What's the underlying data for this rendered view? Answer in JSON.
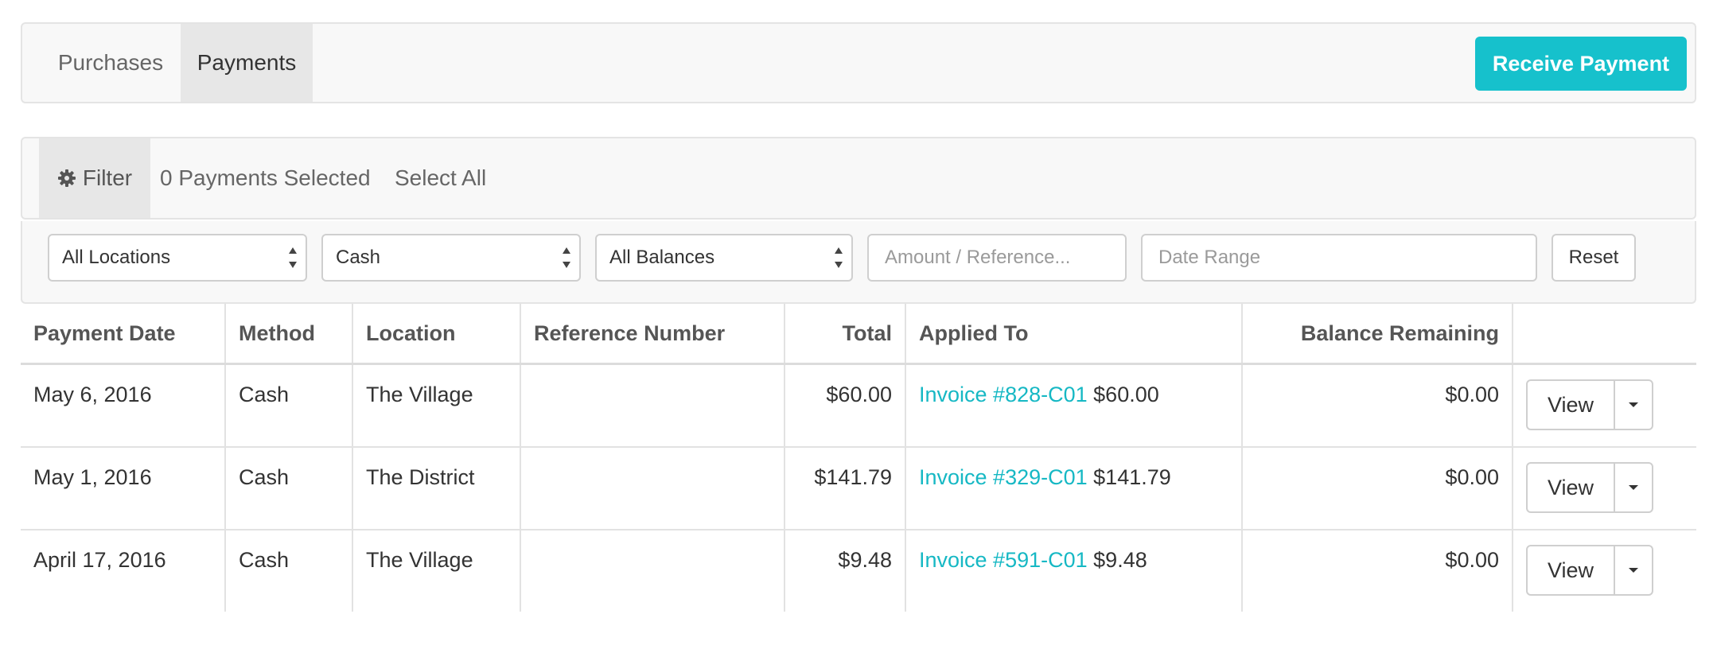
{
  "tabs": {
    "purchases": "Purchases",
    "payments": "Payments",
    "receive_payment": "Receive Payment"
  },
  "filterbar": {
    "filter_label": "Filter",
    "selected_count": "0 Payments Selected",
    "select_all": "Select All"
  },
  "controls": {
    "location_value": "All Locations",
    "method_value": "Cash",
    "balance_value": "All Balances",
    "amount_placeholder": "Amount / Reference...",
    "date_placeholder": "Date Range",
    "reset_label": "Reset"
  },
  "table": {
    "headers": {
      "payment_date": "Payment Date",
      "method": "Method",
      "location": "Location",
      "reference_number": "Reference Number",
      "total": "Total",
      "applied_to": "Applied To",
      "balance_remaining": "Balance Remaining"
    },
    "rows": [
      {
        "date": "May 6, 2016",
        "method": "Cash",
        "location": "The Village",
        "reference": "",
        "total": "$60.00",
        "invoice": "Invoice #828-C01",
        "applied_amount": "$60.00",
        "balance": "$0.00",
        "view": "View"
      },
      {
        "date": "May 1, 2016",
        "method": "Cash",
        "location": "The District",
        "reference": "",
        "total": "$141.79",
        "invoice": "Invoice #329-C01",
        "applied_amount": "$141.79",
        "balance": "$0.00",
        "view": "View"
      },
      {
        "date": "April 17, 2016",
        "method": "Cash",
        "location": "The Village",
        "reference": "",
        "total": "$9.48",
        "invoice": "Invoice #591-C01",
        "applied_amount": "$9.48",
        "balance": "$0.00",
        "view": "View"
      }
    ]
  },
  "colors": {
    "accent": "#16c1cc",
    "link": "#16b8c4"
  },
  "icons": {
    "filter": "gear-icon",
    "select_arrows": "sort-arrows-icon",
    "dropdown": "caret-down-icon"
  }
}
